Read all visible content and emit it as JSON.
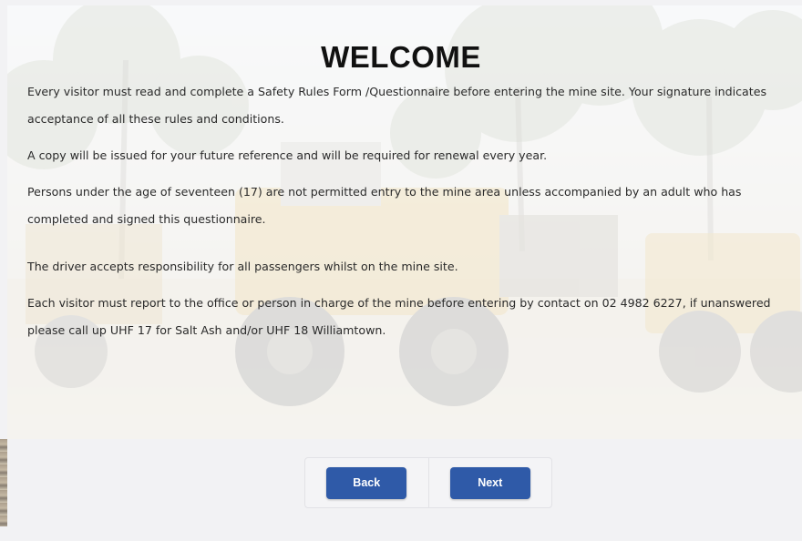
{
  "page": {
    "title": "WELCOME",
    "paragraphs": [
      "Every visitor must read and complete a Safety Rules Form /Questionnaire before entering the mine site. Your signature indicates acceptance of all these rules and conditions.",
      "A copy will be issued for your future reference and will be required for renewal every year.",
      "Persons under the age of seventeen (17) are not permitted entry to the mine area unless accompanied by an adult who has completed and signed this questionnaire.",
      "The driver accepts responsibility for all passengers whilst on the mine site.",
      "Each visitor must report to the office or person in charge of the mine before entering by contact on 02 4982 6227, if unanswered please call up UHF 17 for Salt Ash and/or UHF 18 Williamtown."
    ]
  },
  "navigation": {
    "back_label": "Back",
    "next_label": "Next"
  },
  "colors": {
    "button": "#2f5aa8",
    "footer_background": "#f2f2f4",
    "text": "#2a2a2a"
  }
}
